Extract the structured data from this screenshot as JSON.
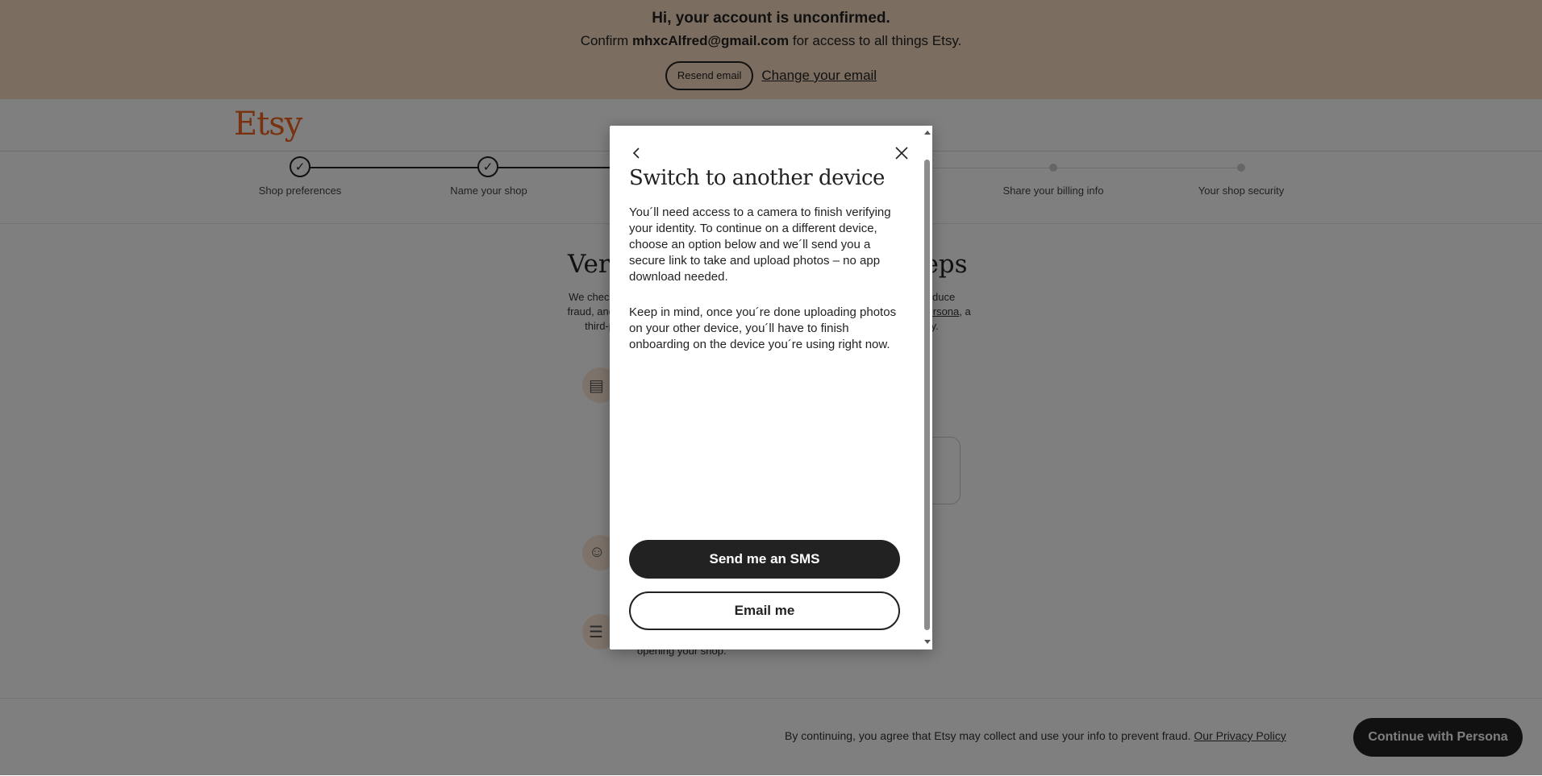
{
  "banner": {
    "title": "Hi, your account is unconfirmed.",
    "confirm_prefix": "Confirm ",
    "email": "mhxcAlfred@gmail.com",
    "confirm_suffix": " for access to all things Etsy.",
    "resend_label": "Resend email",
    "change_label": "Change your email"
  },
  "header": {
    "logo": "Etsy"
  },
  "stepper": {
    "steps": [
      {
        "label": "Shop preferences",
        "status": "complete"
      },
      {
        "label": "Name your shop",
        "status": "complete"
      },
      {
        "label": "Share your billing info",
        "status": "pending"
      },
      {
        "label": "Your shop security",
        "status": "pending"
      }
    ]
  },
  "main": {
    "title_left": "Veri",
    "title_right": "teps",
    "intro_left": "We check fraud, and third-p",
    "intro_right_1": "e, reduce",
    "intro_right_link": "Persona",
    "intro_right_2": ", a",
    "intro_right_3": "curity.",
    "tail_text": "opening your shop."
  },
  "footer": {
    "consent": "By continuing, you agree that Etsy may collect and use your info to prevent fraud.",
    "privacy_link": "Our Privacy Policy",
    "cta_label": "Continue with Persona"
  },
  "modal": {
    "title": "Switch to another device",
    "paragraph1": "You´ll need access to a camera to finish verifying your identity. To continue on a different device, choose an option below and we´ll send you a secure link to take and upload photos – no app download needed.",
    "paragraph2": "Keep in mind, once you´re done uploading photos on your other device, you´ll have to finish onboarding on the device you´re using right now.",
    "sms_label": "Send me an SMS",
    "email_label": "Email me",
    "back_icon": "chevron-left-icon",
    "close_icon": "close-icon"
  },
  "colors": {
    "banner_bg": "#f6dcc1",
    "brand": "#f1641e",
    "primary_button": "#222222"
  }
}
